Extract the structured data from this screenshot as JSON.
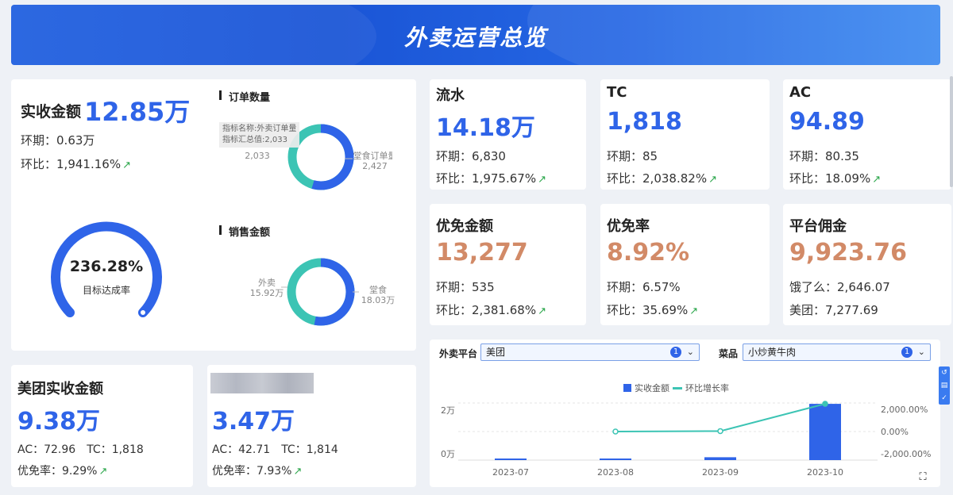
{
  "banner": {
    "title": "外卖运营总览"
  },
  "main": {
    "label": "实收金额",
    "value": "12.85万",
    "period_label": "环期：",
    "period_value": "0.63万",
    "ratio_label": "环比：",
    "ratio_value": "1,941.16%",
    "gauge_value": "236.28%",
    "gauge_label": "目标达成率",
    "gauge_fraction": 1.0
  },
  "orders": {
    "title": "订单数量",
    "tooltip_line1": "指标名称:外卖订单量",
    "tooltip_line2": "指标汇总值:2,033",
    "left_value": "2,033",
    "right_label": "堂食订单量",
    "right_value": "2,427",
    "values": [
      2033,
      2427
    ]
  },
  "sales": {
    "title": "销售金额",
    "left_label": "外卖",
    "left_value": "15.92万",
    "right_label": "堂食",
    "right_value": "18.03万",
    "values": [
      15.92,
      18.03
    ]
  },
  "kpis": [
    {
      "name": "流水",
      "value": "14.18万",
      "l1_label": "环期：",
      "l1_value": "6,830",
      "l2_label": "环比：",
      "l2_value": "1,975.67%"
    },
    {
      "name": "TC",
      "value": "1,818",
      "l1_label": "环期：",
      "l1_value": "85",
      "l2_label": "环比：",
      "l2_value": "2,038.82%"
    },
    {
      "name": "AC",
      "value": "94.89",
      "l1_label": "环期：",
      "l1_value": "80.35",
      "l2_label": "环比：",
      "l2_value": "18.09%"
    },
    {
      "name": "优免金额",
      "value": "13,277",
      "l1_label": "环期：",
      "l1_value": "535",
      "l2_label": "环比：",
      "l2_value": "2,381.68%"
    },
    {
      "name": "优免率",
      "value": "8.92%",
      "l1_label": "环期：",
      "l1_value": "6.57%",
      "l2_label": "环比：",
      "l2_value": "35.69%"
    },
    {
      "name": "平台佣金",
      "value": "9,923.76",
      "l1_label": "饿了么：",
      "l1_value": "2,646.07",
      "l2_label": "美团：",
      "l2_value": "7,277.69"
    }
  ],
  "meituan": {
    "label": "美团实收金额",
    "value": "9.38万",
    "ac": "AC：72.96",
    "tc": "TC：1,818",
    "rate_label": "优免率：",
    "rate_value": "9.29%"
  },
  "other": {
    "value": "3.47万",
    "ac": "AC：42.71",
    "tc": "TC：1,814",
    "rate_label": "优免率：",
    "rate_value": "7.93%"
  },
  "filters": {
    "platform_label": "外卖平台",
    "platform_value": "美团",
    "platform_count": "1",
    "dish_label": "菜品",
    "dish_value": "小炒黄牛肉",
    "dish_count": "1"
  },
  "colors": {
    "primary": "#2f64e8",
    "teal": "#3cc4b4",
    "orange": "#d28a67",
    "up": "#2aa64a"
  },
  "chart_data": {
    "type": "bar",
    "categories": [
      "2023-07",
      "2023-08",
      "2023-09",
      "2023-10"
    ],
    "series": [
      {
        "name": "实收金额",
        "type": "bar",
        "axis": "left",
        "values": [
          150,
          200,
          1000,
          19700
        ]
      },
      {
        "name": "环比增长率",
        "type": "line",
        "axis": "right",
        "values": [
          null,
          0,
          30,
          1941.16
        ]
      }
    ],
    "y_left_ticks": [
      "2万",
      "0万"
    ],
    "y_right_ticks": [
      "2,000.00%",
      "0.00%",
      "-2,000.00%"
    ],
    "ylim_left": [
      0,
      20000
    ],
    "ylim_right": [
      -2000,
      2000
    ],
    "legend_position": "top-center"
  }
}
